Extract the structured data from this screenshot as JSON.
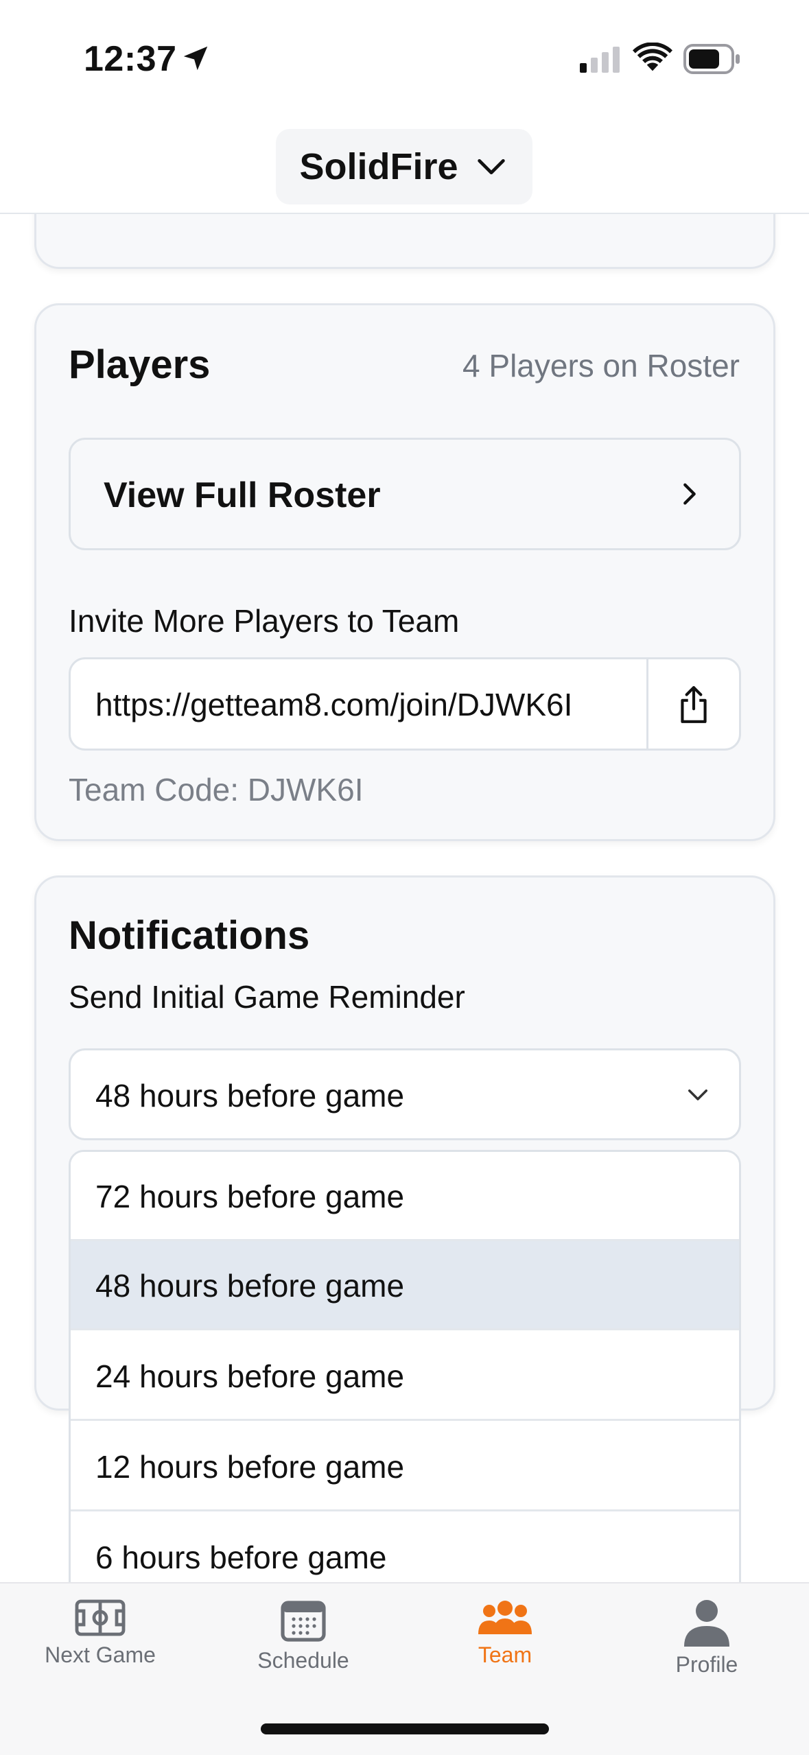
{
  "status_bar": {
    "time": "12:37"
  },
  "header": {
    "team_name": "SolidFire"
  },
  "players": {
    "title": "Players",
    "roster_count": "4 Players on Roster",
    "view_roster_label": "View Full Roster",
    "invite_label": "Invite More Players to Team",
    "invite_url": "https://getteam8.com/join/DJWK6I",
    "team_code": "Team Code: DJWK6I"
  },
  "notifications": {
    "title": "Notifications",
    "reminder_label": "Send Initial Game Reminder",
    "selected": "48 hours before game",
    "options": [
      "72 hours before game",
      "48 hours before game",
      "24 hours before game",
      "12 hours before game",
      "6 hours before game"
    ]
  },
  "tabs": [
    {
      "label": "Next Game",
      "icon": "field-icon"
    },
    {
      "label": "Schedule",
      "icon": "calendar-icon"
    },
    {
      "label": "Team",
      "icon": "team-icon",
      "active": true
    },
    {
      "label": "Profile",
      "icon": "person-icon"
    }
  ],
  "colors": {
    "accent": "#f07416",
    "card_bg": "#f7f8fa",
    "selected_option": "#e2e8f0"
  }
}
